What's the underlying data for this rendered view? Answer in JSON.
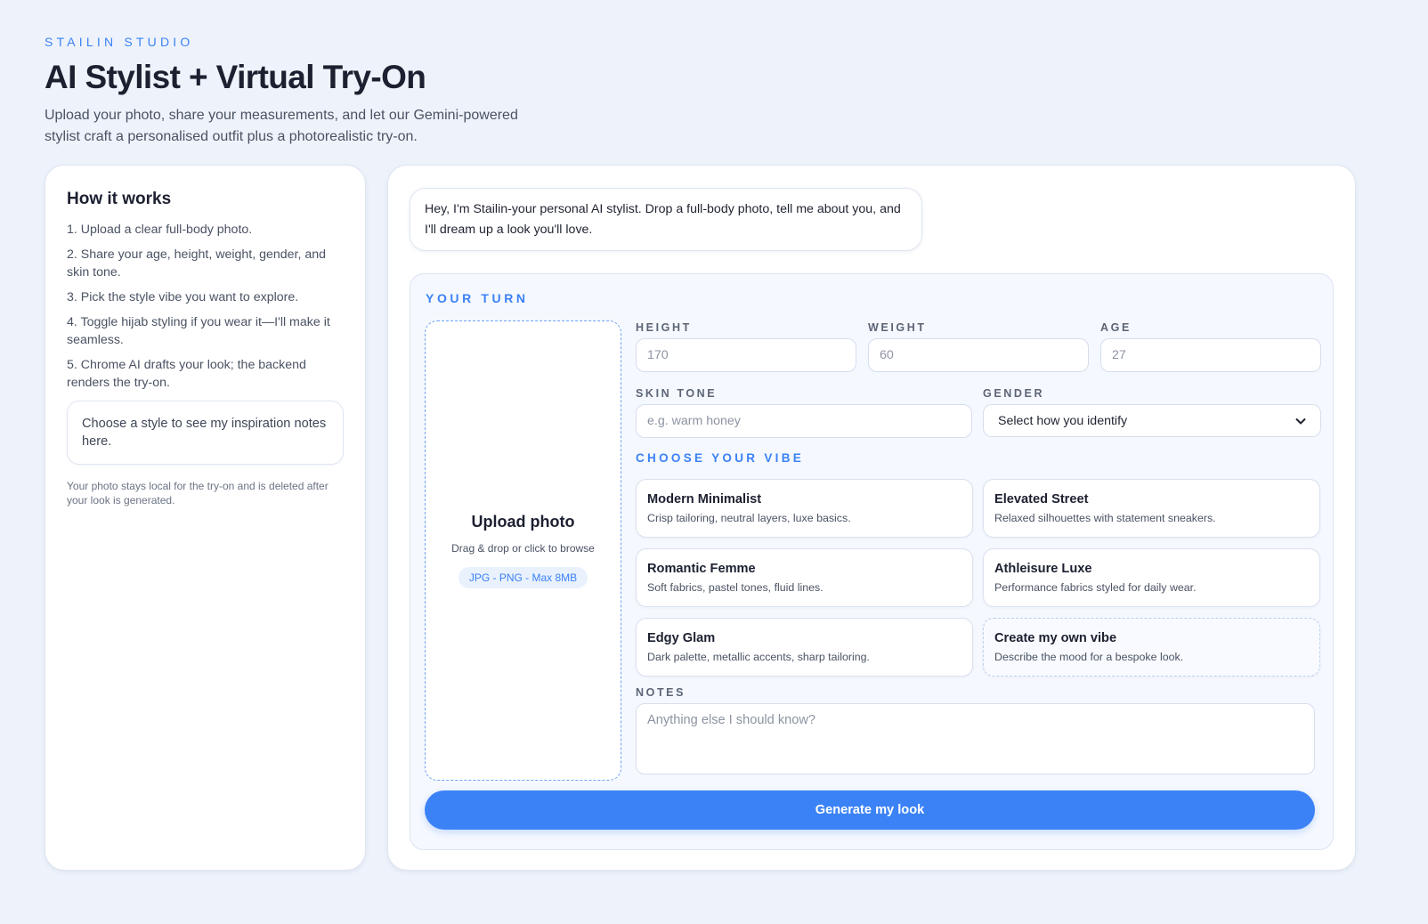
{
  "header": {
    "brand": "STAILIN STUDIO",
    "title": "AI Stylist + Virtual Try-On",
    "subtitle": "Upload your photo, share your measurements, and let our Gemini-powered stylist craft a personalised outfit plus a photorealistic try-on."
  },
  "how_it_works": {
    "title": "How it works",
    "steps": [
      "1. Upload a clear full-body photo.",
      "2. Share your age, height, weight, gender, and skin tone.",
      "3. Pick the style vibe you want to explore.",
      "4. Toggle hijab styling if you wear it—I'll make it seamless.",
      "5. Chrome AI drafts your look; the backend renders the try-on."
    ],
    "inspiration_placeholder": "Choose a style to see my inspiration notes here.",
    "privacy_note": "Your photo stays local for the try-on and is deleted after your look is generated."
  },
  "chat": {
    "greeting": "Hey, I'm Stailin-your personal AI stylist. Drop a full-body photo, tell me about you, and I'll dream up a look you'll love."
  },
  "form": {
    "section_label": "YOUR TURN",
    "upload": {
      "title": "Upload photo",
      "subtitle": "Drag & drop or click to browse",
      "formats": "JPG - PNG - Max 8MB"
    },
    "height": {
      "label": "HEIGHT",
      "placeholder": "170"
    },
    "weight": {
      "label": "WEIGHT",
      "placeholder": "60"
    },
    "age": {
      "label": "AGE",
      "placeholder": "27"
    },
    "skin_tone": {
      "label": "SKIN TONE",
      "placeholder": "e.g. warm honey"
    },
    "gender": {
      "label": "GENDER",
      "selected": "Select how you identify"
    },
    "vibe_label": "CHOOSE YOUR VIBE",
    "vibes": [
      {
        "title": "Modern Minimalist",
        "desc": "Crisp tailoring, neutral layers, luxe basics."
      },
      {
        "title": "Elevated Street",
        "desc": "Relaxed silhouettes with statement sneakers."
      },
      {
        "title": "Romantic Femme",
        "desc": "Soft fabrics, pastel tones, fluid lines."
      },
      {
        "title": "Athleisure Luxe",
        "desc": "Performance fabrics styled for daily wear."
      },
      {
        "title": "Edgy Glam",
        "desc": "Dark palette, metallic accents, sharp tailoring."
      },
      {
        "title": "Create my own vibe",
        "desc": "Describe the mood for a bespoke look."
      }
    ],
    "notes": {
      "label": "NOTES",
      "placeholder": "Anything else I should know?"
    },
    "submit_label": "Generate my look"
  },
  "colors": {
    "accent": "#3b82f6",
    "background": "#eef3fb",
    "panel": "#f5f8fe"
  },
  "icons": {
    "select_chevron": "chevron-down-icon"
  }
}
